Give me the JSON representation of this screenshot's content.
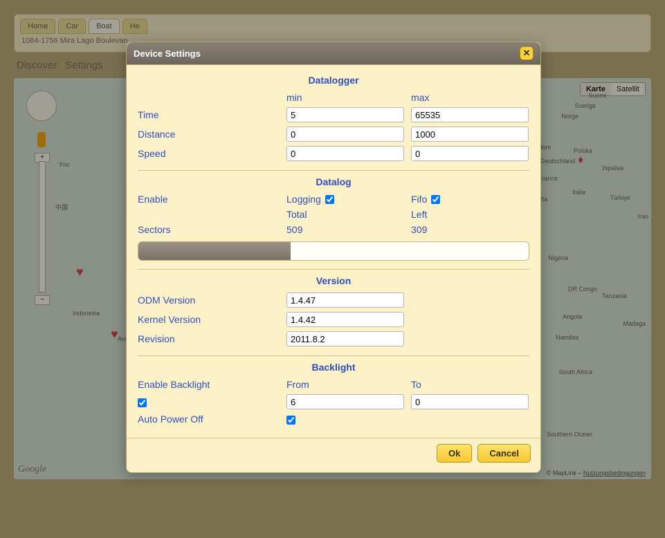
{
  "bg": {
    "tabs": [
      "Home",
      "Car",
      "Boat",
      "He"
    ],
    "active_tab_index": 2,
    "address": "1084-1756 Mira Lago Boulevan",
    "subtabs": [
      "Discover",
      "Settings"
    ],
    "map_toggle": {
      "karte": "Karte",
      "satellit": "Satellit"
    },
    "google": "Google",
    "attrib_prefix": "© MapLink – ",
    "attrib_link": "Nutzungsbedingungen",
    "places": [
      "Suomi",
      "Sverige",
      "Norge",
      "United Kingdom",
      "Polska",
      "Deutschland",
      "France",
      "Україна",
      "España",
      "Italia",
      "Türkiye",
      "中国",
      "Indonesia",
      "Austra",
      "Nigeria",
      "DR Congo",
      "Angola",
      "Namibia",
      "Tanzania",
      "South Africa",
      "Madaga",
      "Southern Ocean",
      "Iran",
      "Ync"
    ]
  },
  "modal": {
    "title": "Device Settings",
    "close_icon_label": "✕",
    "datalogger": {
      "title": "Datalogger",
      "min_label": "min",
      "max_label": "max",
      "time_label": "Time",
      "time_min": "5",
      "time_max": "65535",
      "distance_label": "Distance",
      "distance_min": "0",
      "distance_max": "1000",
      "speed_label": "Speed",
      "speed_min": "0",
      "speed_max": "0"
    },
    "datalog": {
      "title": "Datalog",
      "enable_label": "Enable",
      "logging_label": "Logging",
      "logging_checked": true,
      "fifo_label": "Fifo",
      "fifo_checked": true,
      "total_label": "Total",
      "left_label": "Left",
      "sectors_label": "Sectors",
      "sectors_total": "509",
      "sectors_left": "309",
      "progress_percent": 39
    },
    "version": {
      "title": "Version",
      "odm_label": "ODM Version",
      "odm_value": "1.4.47",
      "kernel_label": "Kernel Version",
      "kernel_value": "1.4.42",
      "revision_label": "Revision",
      "revision_value": "2011.8.2"
    },
    "backlight": {
      "title": "Backlight",
      "enable_label": "Enable Backlight",
      "enable_checked": true,
      "from_label": "From",
      "from_value": "6",
      "to_label": "To",
      "to_value": "0",
      "auto_off_label": "Auto Power Off",
      "auto_off_checked": true
    },
    "buttons": {
      "ok": "Ok",
      "cancel": "Cancel"
    }
  }
}
